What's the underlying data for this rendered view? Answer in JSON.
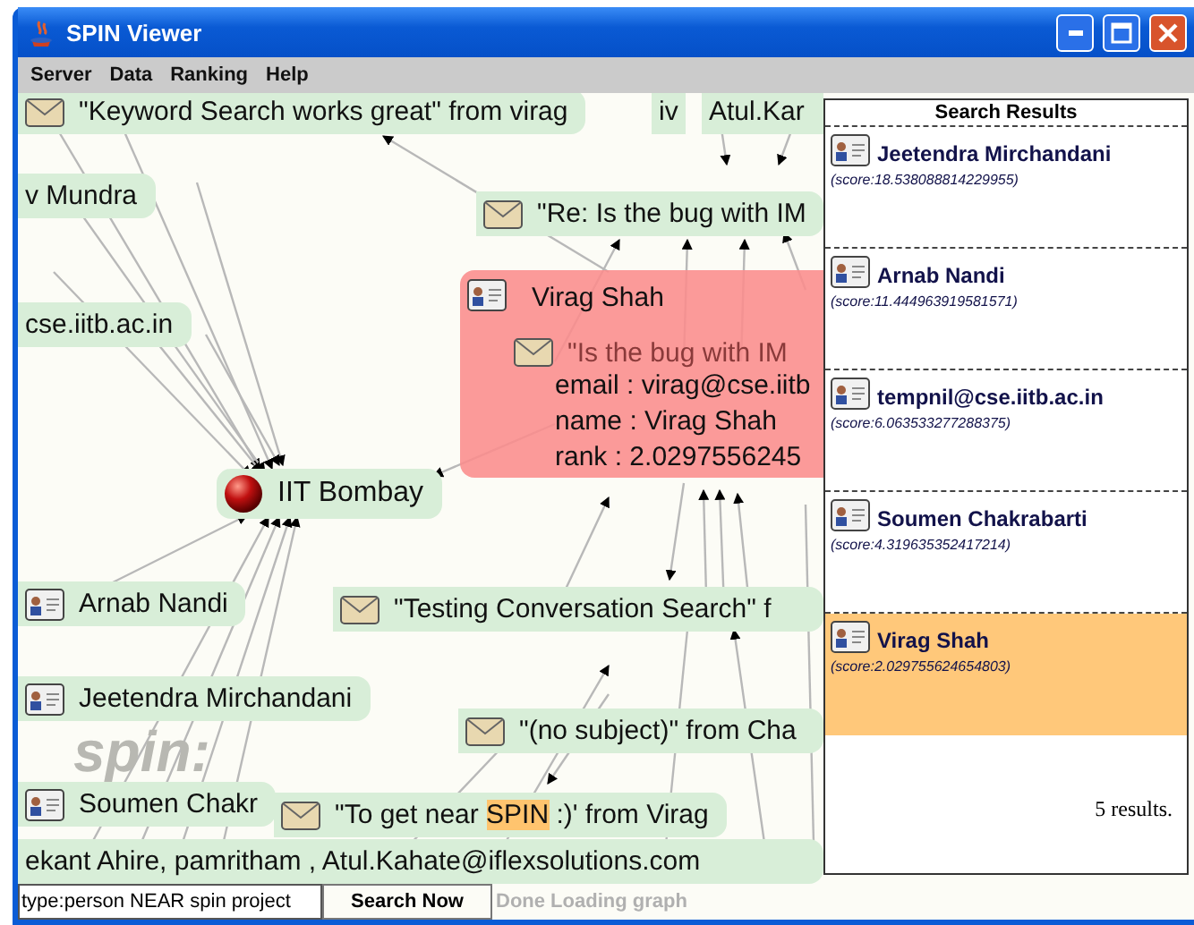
{
  "window": {
    "title": "SPIN Viewer"
  },
  "menu": [
    "Server",
    "Data",
    "Ranking",
    "Help"
  ],
  "graph": {
    "logo": "spin:",
    "nodes": [
      {
        "kind": "message",
        "label": "\"Keyword Search works great\" from virag"
      },
      {
        "kind": "fragment",
        "label": "iv"
      },
      {
        "kind": "fragment",
        "label": "Atul.Kar"
      },
      {
        "kind": "text",
        "label": "v Mundra"
      },
      {
        "kind": "text",
        "label": "cse.iitb.ac.in"
      },
      {
        "kind": "message",
        "label": "\"Re: Is the bug with IM"
      },
      {
        "kind": "organization",
        "label": "IIT Bombay"
      },
      {
        "kind": "person",
        "label": "Arnab Nandi"
      },
      {
        "kind": "message",
        "label": "\"Testing Conversation Search\" f"
      },
      {
        "kind": "person",
        "label": "Jeetendra Mirchandani"
      },
      {
        "kind": "message",
        "label": "\"(no subject)\" from Cha"
      },
      {
        "kind": "person",
        "label": "Soumen Chakr"
      },
      {
        "kind": "message",
        "label": "\"To get near ",
        "highlight": "SPIN",
        "label_after": " :)' from Virag"
      },
      {
        "kind": "text",
        "label": "ekant Ahire, pamritham , Atul.Kahate@iflexsolutions.com"
      }
    ],
    "tooltip": {
      "title": "Virag Shah",
      "behind": "\"Is the bug with IM",
      "lines": [
        "email : virag@cse.iitb",
        "name : Virag Shah",
        "rank : 2.0297556245"
      ]
    }
  },
  "results": {
    "title": "Search Results",
    "items": [
      {
        "name": "Jeetendra Mirchandani",
        "score": "(score:18.538088814229955)",
        "selected": false
      },
      {
        "name": "Arnab Nandi",
        "score": "(score:11.444963919581571)",
        "selected": false
      },
      {
        "name": "tempnil@cse.iitb.ac.in",
        "score": "(score:6.063533277288375)",
        "selected": false
      },
      {
        "name": "Soumen Chakrabarti",
        "score": "(score:4.319635352417214)",
        "selected": false
      },
      {
        "name": "Virag Shah",
        "score": "(score:2.029755624654803)",
        "selected": true
      }
    ],
    "summary": "5 results."
  },
  "search": {
    "value": "type:person NEAR spin project",
    "button": "Search Now",
    "status": "Done Loading graph"
  }
}
